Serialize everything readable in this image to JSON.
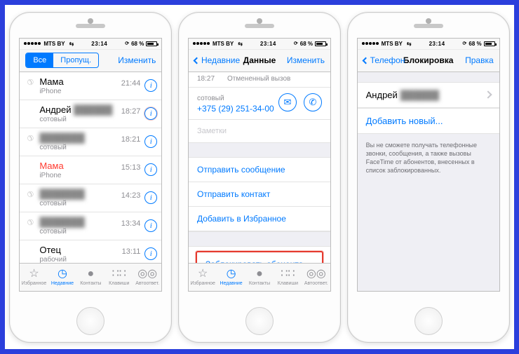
{
  "status": {
    "carrier": "MTS BY",
    "time": "23:14",
    "battery": "68 %"
  },
  "phone1": {
    "seg_all": "Все",
    "seg_missed": "Пропущ.",
    "edit": "Изменить",
    "rows": [
      {
        "name": "Мама",
        "sub": "iPhone",
        "time": "21:44",
        "missed": false
      },
      {
        "name": "Андрей",
        "redacted": true,
        "sub": "сотовый",
        "time": "18:27",
        "missed": false,
        "highlight": true
      },
      {
        "name": "",
        "redacted_name": true,
        "sub": "сотовый",
        "time": "18:21",
        "missed": false
      },
      {
        "name": "Мама",
        "sub": "iPhone",
        "time": "15:13",
        "missed": true
      },
      {
        "name": "",
        "redacted_name": true,
        "sub": "сотовый",
        "time": "14:23",
        "missed": false
      },
      {
        "name": "",
        "redacted_name": true,
        "sub": "сотовый",
        "time": "13:34",
        "missed": false
      },
      {
        "name": "Отец",
        "sub": "рабочий",
        "time": "13:11",
        "missed": false
      }
    ]
  },
  "phone2": {
    "back": "Недавние",
    "title": "Данные",
    "edit": "Изменить",
    "time_line": "18:27",
    "status_line": "Отмененный вызов",
    "label_cell": "сотовый",
    "number": "+375 (29) 251-34-00",
    "notes": "Заметки",
    "actions": {
      "send_msg": "Отправить сообщение",
      "send_contact": "Отправить контакт",
      "add_fav": "Добавить в Избранное",
      "block": "Заблокировать абонента"
    }
  },
  "phone3": {
    "back": "Телефон",
    "title": "Блокировка",
    "edit": "Правка",
    "contact_name": "Андрей",
    "add_new": "Добавить новый...",
    "note": "Вы не сможете получать телефонные звонки, сообщения, а также вызовы FaceTime от абонентов, внесенных в список заблокированных."
  },
  "tabs": {
    "fav": "Избранное",
    "recent": "Недавние",
    "contacts": "Контакты",
    "keypad": "Клавиши",
    "voicemail": "Автоответ."
  }
}
